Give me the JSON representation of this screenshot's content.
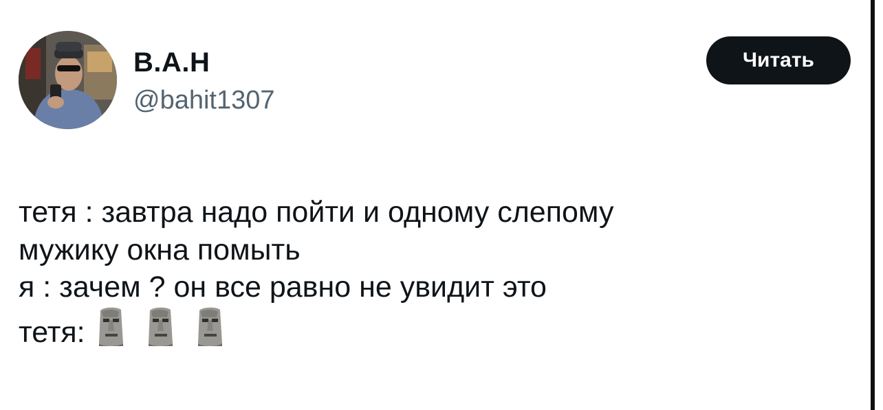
{
  "author": {
    "display_name": "В.А.Н",
    "handle": "@bahit1307",
    "avatar_icon": "profile-photo"
  },
  "follow_button": {
    "label": "Читать",
    "color": "#0f1419"
  },
  "tweet": {
    "lines": [
      "тетя : завтра надо пойти и одному слепому",
      "мужику окна помыть",
      "я : зачем ? он все равно не увидит это",
      "тетя:"
    ],
    "emoji": [
      "moai-emoji",
      "moai-emoji",
      "moai-emoji"
    ]
  }
}
